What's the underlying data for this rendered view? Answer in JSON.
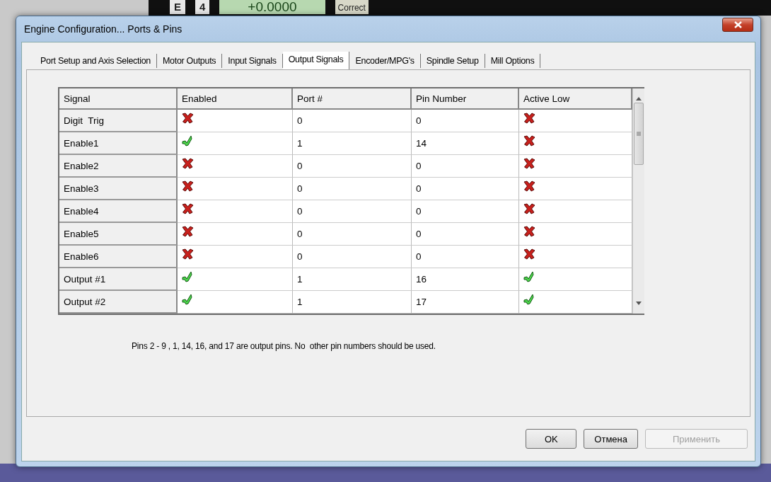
{
  "background_app": {
    "labels": [
      "E",
      "4",
      "+0.0000",
      "Correct"
    ]
  },
  "window": {
    "title": "Engine Configuration... Ports & Pins"
  },
  "tabs": [
    {
      "label": "Port Setup and Axis Selection",
      "selected": false
    },
    {
      "label": "Motor Outputs",
      "selected": false
    },
    {
      "label": "Input Signals",
      "selected": false
    },
    {
      "label": "Output Signals",
      "selected": true
    },
    {
      "label": "Encoder/MPG's",
      "selected": false
    },
    {
      "label": "Spindle Setup",
      "selected": false
    },
    {
      "label": "Mill Options",
      "selected": false
    }
  ],
  "table": {
    "columns": [
      "Signal",
      "Enabled",
      "Port #",
      "Pin Number",
      "Active Low"
    ],
    "rows": [
      {
        "signal": "Digit  Trig",
        "enabled": false,
        "port": "0",
        "pin": "0",
        "active_low": false
      },
      {
        "signal": "Enable1",
        "enabled": true,
        "port": "1",
        "pin": "14",
        "active_low": false
      },
      {
        "signal": "Enable2",
        "enabled": false,
        "port": "0",
        "pin": "0",
        "active_low": false
      },
      {
        "signal": "Enable3",
        "enabled": false,
        "port": "0",
        "pin": "0",
        "active_low": false
      },
      {
        "signal": "Enable4",
        "enabled": false,
        "port": "0",
        "pin": "0",
        "active_low": false
      },
      {
        "signal": "Enable5",
        "enabled": false,
        "port": "0",
        "pin": "0",
        "active_low": false
      },
      {
        "signal": "Enable6",
        "enabled": false,
        "port": "0",
        "pin": "0",
        "active_low": false
      },
      {
        "signal": "Output #1",
        "enabled": true,
        "port": "1",
        "pin": "16",
        "active_low": true
      },
      {
        "signal": "Output #2",
        "enabled": true,
        "port": "1",
        "pin": "17",
        "active_low": true
      }
    ]
  },
  "note": "Pins 2 - 9 , 1, 14, 16, and 17 are output pins. No  other pin numbers should be used.",
  "buttons": [
    {
      "label": "OK",
      "disabled": false
    },
    {
      "label": "Отмена",
      "disabled": false
    },
    {
      "label": "Применить",
      "disabled": true
    }
  ]
}
